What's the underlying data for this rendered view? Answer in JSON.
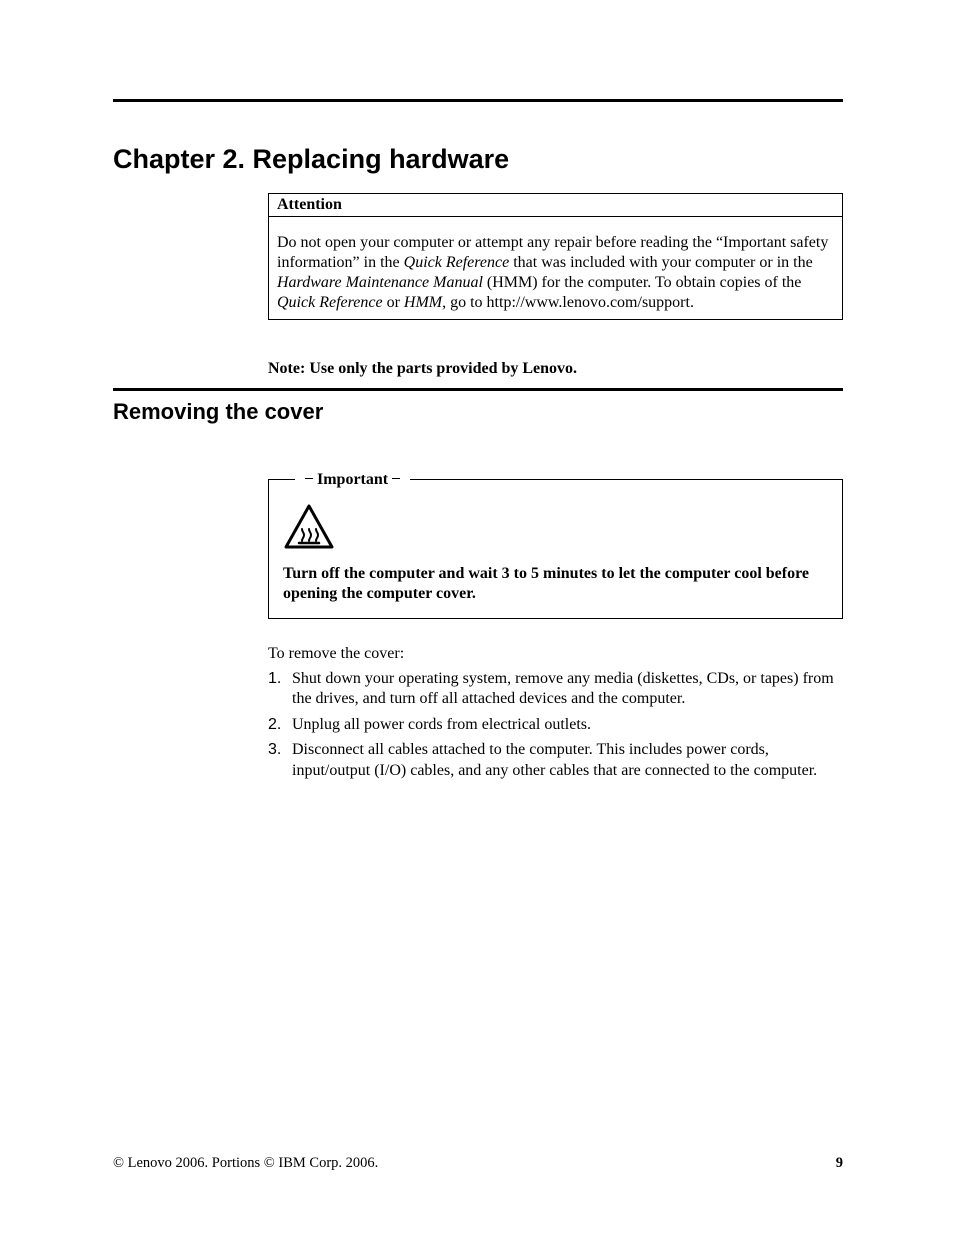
{
  "chapter_title": "Chapter 2. Replacing hardware",
  "attention": {
    "heading": "Attention",
    "para_pre": "Do not open your computer or attempt any repair before reading the “Important safety information” in the ",
    "qr1": "Quick Reference",
    "mid1": " that was included with your computer or in the ",
    "hmm_full": "Hardware Maintenance Manual",
    "mid2": " (HMM) for the computer. To obtain copies of the ",
    "qr2": "Quick Reference",
    "mid3": " or ",
    "hmm_short": "HMM",
    "tail": ", go to http://www.lenovo.com/support."
  },
  "note": "Note:  Use only the parts provided by Lenovo.",
  "section_title": "Removing the cover",
  "important": {
    "legend": "Important",
    "text": "Turn off the computer and wait 3 to 5 minutes to let the computer cool before opening the computer cover."
  },
  "lead": "To remove the cover:",
  "steps": [
    "Shut down your operating system, remove any media (diskettes, CDs, or tapes) from the drives, and turn off all attached devices and the computer.",
    "Unplug all power cords from electrical outlets.",
    "Disconnect all cables attached to the computer. This includes power cords, input/output (I/O) cables, and any other cables that are connected to the computer."
  ],
  "footer": {
    "copyright": "© Lenovo 2006. Portions © IBM Corp. 2006.",
    "page": "9"
  }
}
